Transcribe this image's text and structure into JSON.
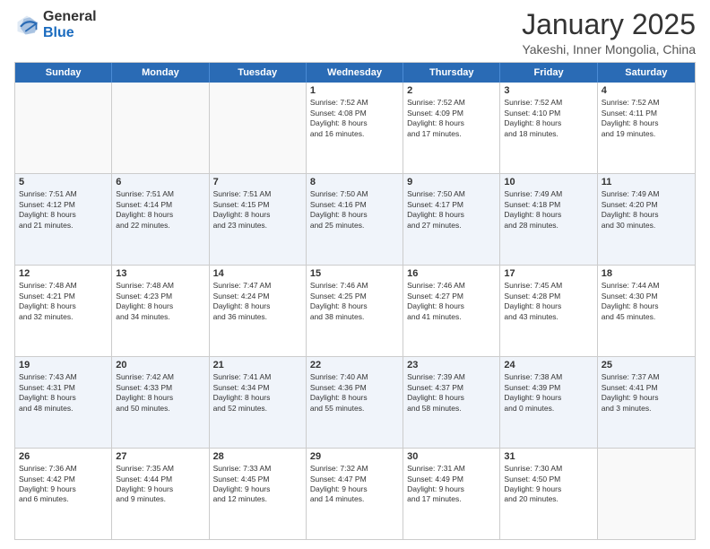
{
  "header": {
    "logo_general": "General",
    "logo_blue": "Blue",
    "month": "January 2025",
    "location": "Yakeshi, Inner Mongolia, China"
  },
  "days_of_week": [
    "Sunday",
    "Monday",
    "Tuesday",
    "Wednesday",
    "Thursday",
    "Friday",
    "Saturday"
  ],
  "weeks": [
    [
      {
        "day": "",
        "info": ""
      },
      {
        "day": "",
        "info": ""
      },
      {
        "day": "",
        "info": ""
      },
      {
        "day": "1",
        "info": "Sunrise: 7:52 AM\nSunset: 4:08 PM\nDaylight: 8 hours\nand 16 minutes."
      },
      {
        "day": "2",
        "info": "Sunrise: 7:52 AM\nSunset: 4:09 PM\nDaylight: 8 hours\nand 17 minutes."
      },
      {
        "day": "3",
        "info": "Sunrise: 7:52 AM\nSunset: 4:10 PM\nDaylight: 8 hours\nand 18 minutes."
      },
      {
        "day": "4",
        "info": "Sunrise: 7:52 AM\nSunset: 4:11 PM\nDaylight: 8 hours\nand 19 minutes."
      }
    ],
    [
      {
        "day": "5",
        "info": "Sunrise: 7:51 AM\nSunset: 4:12 PM\nDaylight: 8 hours\nand 21 minutes."
      },
      {
        "day": "6",
        "info": "Sunrise: 7:51 AM\nSunset: 4:14 PM\nDaylight: 8 hours\nand 22 minutes."
      },
      {
        "day": "7",
        "info": "Sunrise: 7:51 AM\nSunset: 4:15 PM\nDaylight: 8 hours\nand 23 minutes."
      },
      {
        "day": "8",
        "info": "Sunrise: 7:50 AM\nSunset: 4:16 PM\nDaylight: 8 hours\nand 25 minutes."
      },
      {
        "day": "9",
        "info": "Sunrise: 7:50 AM\nSunset: 4:17 PM\nDaylight: 8 hours\nand 27 minutes."
      },
      {
        "day": "10",
        "info": "Sunrise: 7:49 AM\nSunset: 4:18 PM\nDaylight: 8 hours\nand 28 minutes."
      },
      {
        "day": "11",
        "info": "Sunrise: 7:49 AM\nSunset: 4:20 PM\nDaylight: 8 hours\nand 30 minutes."
      }
    ],
    [
      {
        "day": "12",
        "info": "Sunrise: 7:48 AM\nSunset: 4:21 PM\nDaylight: 8 hours\nand 32 minutes."
      },
      {
        "day": "13",
        "info": "Sunrise: 7:48 AM\nSunset: 4:23 PM\nDaylight: 8 hours\nand 34 minutes."
      },
      {
        "day": "14",
        "info": "Sunrise: 7:47 AM\nSunset: 4:24 PM\nDaylight: 8 hours\nand 36 minutes."
      },
      {
        "day": "15",
        "info": "Sunrise: 7:46 AM\nSunset: 4:25 PM\nDaylight: 8 hours\nand 38 minutes."
      },
      {
        "day": "16",
        "info": "Sunrise: 7:46 AM\nSunset: 4:27 PM\nDaylight: 8 hours\nand 41 minutes."
      },
      {
        "day": "17",
        "info": "Sunrise: 7:45 AM\nSunset: 4:28 PM\nDaylight: 8 hours\nand 43 minutes."
      },
      {
        "day": "18",
        "info": "Sunrise: 7:44 AM\nSunset: 4:30 PM\nDaylight: 8 hours\nand 45 minutes."
      }
    ],
    [
      {
        "day": "19",
        "info": "Sunrise: 7:43 AM\nSunset: 4:31 PM\nDaylight: 8 hours\nand 48 minutes."
      },
      {
        "day": "20",
        "info": "Sunrise: 7:42 AM\nSunset: 4:33 PM\nDaylight: 8 hours\nand 50 minutes."
      },
      {
        "day": "21",
        "info": "Sunrise: 7:41 AM\nSunset: 4:34 PM\nDaylight: 8 hours\nand 52 minutes."
      },
      {
        "day": "22",
        "info": "Sunrise: 7:40 AM\nSunset: 4:36 PM\nDaylight: 8 hours\nand 55 minutes."
      },
      {
        "day": "23",
        "info": "Sunrise: 7:39 AM\nSunset: 4:37 PM\nDaylight: 8 hours\nand 58 minutes."
      },
      {
        "day": "24",
        "info": "Sunrise: 7:38 AM\nSunset: 4:39 PM\nDaylight: 9 hours\nand 0 minutes."
      },
      {
        "day": "25",
        "info": "Sunrise: 7:37 AM\nSunset: 4:41 PM\nDaylight: 9 hours\nand 3 minutes."
      }
    ],
    [
      {
        "day": "26",
        "info": "Sunrise: 7:36 AM\nSunset: 4:42 PM\nDaylight: 9 hours\nand 6 minutes."
      },
      {
        "day": "27",
        "info": "Sunrise: 7:35 AM\nSunset: 4:44 PM\nDaylight: 9 hours\nand 9 minutes."
      },
      {
        "day": "28",
        "info": "Sunrise: 7:33 AM\nSunset: 4:45 PM\nDaylight: 9 hours\nand 12 minutes."
      },
      {
        "day": "29",
        "info": "Sunrise: 7:32 AM\nSunset: 4:47 PM\nDaylight: 9 hours\nand 14 minutes."
      },
      {
        "day": "30",
        "info": "Sunrise: 7:31 AM\nSunset: 4:49 PM\nDaylight: 9 hours\nand 17 minutes."
      },
      {
        "day": "31",
        "info": "Sunrise: 7:30 AM\nSunset: 4:50 PM\nDaylight: 9 hours\nand 20 minutes."
      },
      {
        "day": "",
        "info": ""
      }
    ]
  ]
}
